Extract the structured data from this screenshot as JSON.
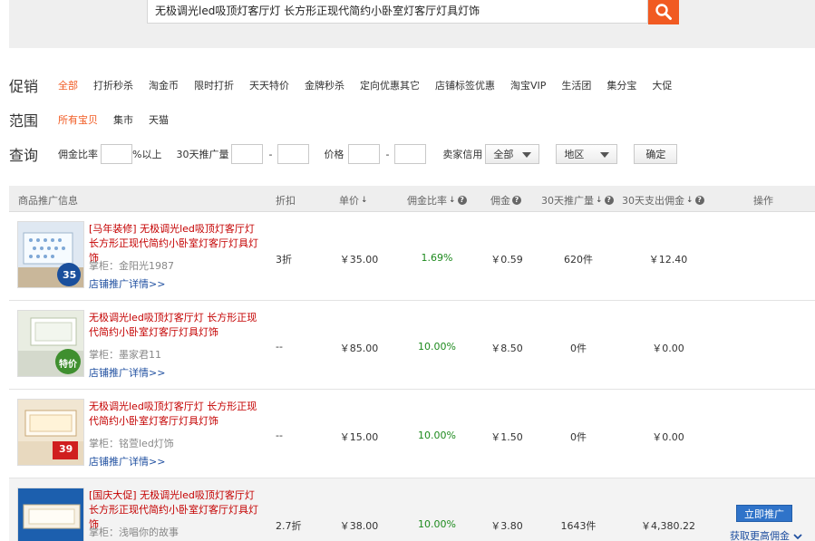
{
  "search": {
    "query": "无极调光led吸顶灯客厅灯 长方形正现代简约小卧室灯客厅灯具灯饰"
  },
  "filters": {
    "promo": {
      "label": "促销",
      "options": [
        "全部",
        "打折秒杀",
        "淘金币",
        "限时打折",
        "天天特价",
        "金牌秒杀",
        "定向优惠其它",
        "店铺标签优惠",
        "淘宝VIP",
        "生活团",
        "集分宝",
        "大促"
      ],
      "active_index": 0
    },
    "scope": {
      "label": "范围",
      "options": [
        "所有宝贝",
        "集市",
        "天猫"
      ],
      "active_index": 0
    },
    "query": {
      "label": "查询",
      "commission_label": "佣金比率",
      "commission_suffix": "%以上",
      "sales_label": "30天推广量",
      "dash": "-",
      "price_label": "价格",
      "credit_label": "卖家信用",
      "credit_value": "全部",
      "region_value": "地区",
      "confirm_label": "确定"
    }
  },
  "table": {
    "headers": {
      "product": "商品推广信息",
      "discount": "折扣",
      "price": "单价",
      "rate": "佣金比率",
      "commission": "佣金",
      "sales": "30天推广量",
      "payout": "30天支出佣金",
      "action": "操作"
    },
    "rows": [
      {
        "title": "[马年装修] 无极调光led吸顶灯客厅灯 长方形正现代简约小卧室灯客厅灯具灯饰",
        "seller": "掌柜：金阳光1987",
        "link": "店铺推广详情>>",
        "discount": "3折",
        "price": "￥35.00",
        "rate": "1.69%",
        "commission": "￥0.59",
        "sales": "620件",
        "payout": "￥12.40",
        "thumb_badge": "35"
      },
      {
        "title": "无极调光led吸顶灯客厅灯 长方形正现代简约小卧室灯客厅灯具灯饰",
        "seller": "掌柜：墨家君11",
        "link": "店铺推广详情>>",
        "discount": "--",
        "price": "￥85.00",
        "rate": "10.00%",
        "commission": "￥8.50",
        "sales": "0件",
        "payout": "￥0.00",
        "thumb_badge": "特价"
      },
      {
        "title": "无极调光led吸顶灯客厅灯 长方形正现代简约小卧室灯客厅灯具灯饰",
        "seller": "掌柜：铭萱led灯饰",
        "link": "店铺推广详情>>",
        "discount": "--",
        "price": "￥15.00",
        "rate": "10.00%",
        "commission": "￥1.50",
        "sales": "0件",
        "payout": "￥0.00",
        "thumb_badge": "39"
      },
      {
        "title": "[国庆大促] 无极调光led吸顶灯客厅灯 长方形正现代简约小卧室灯客厅灯具灯饰",
        "seller": "掌柜：浅唱你的故事",
        "link": "",
        "discount": "2.7折",
        "price": "￥38.00",
        "rate": "10.00%",
        "commission": "￥3.80",
        "sales": "1643件",
        "payout": "￥4,380.22",
        "promote_label": "立即推广",
        "more_label": "获取更高佣金",
        "thumb_badge": ""
      }
    ]
  },
  "colors": {
    "accent": "#f15a22",
    "title_red": "#c40000",
    "link_blue": "#1f4fa0",
    "rate_green": "#1d8a1d",
    "button_blue": "#2f73c9"
  }
}
